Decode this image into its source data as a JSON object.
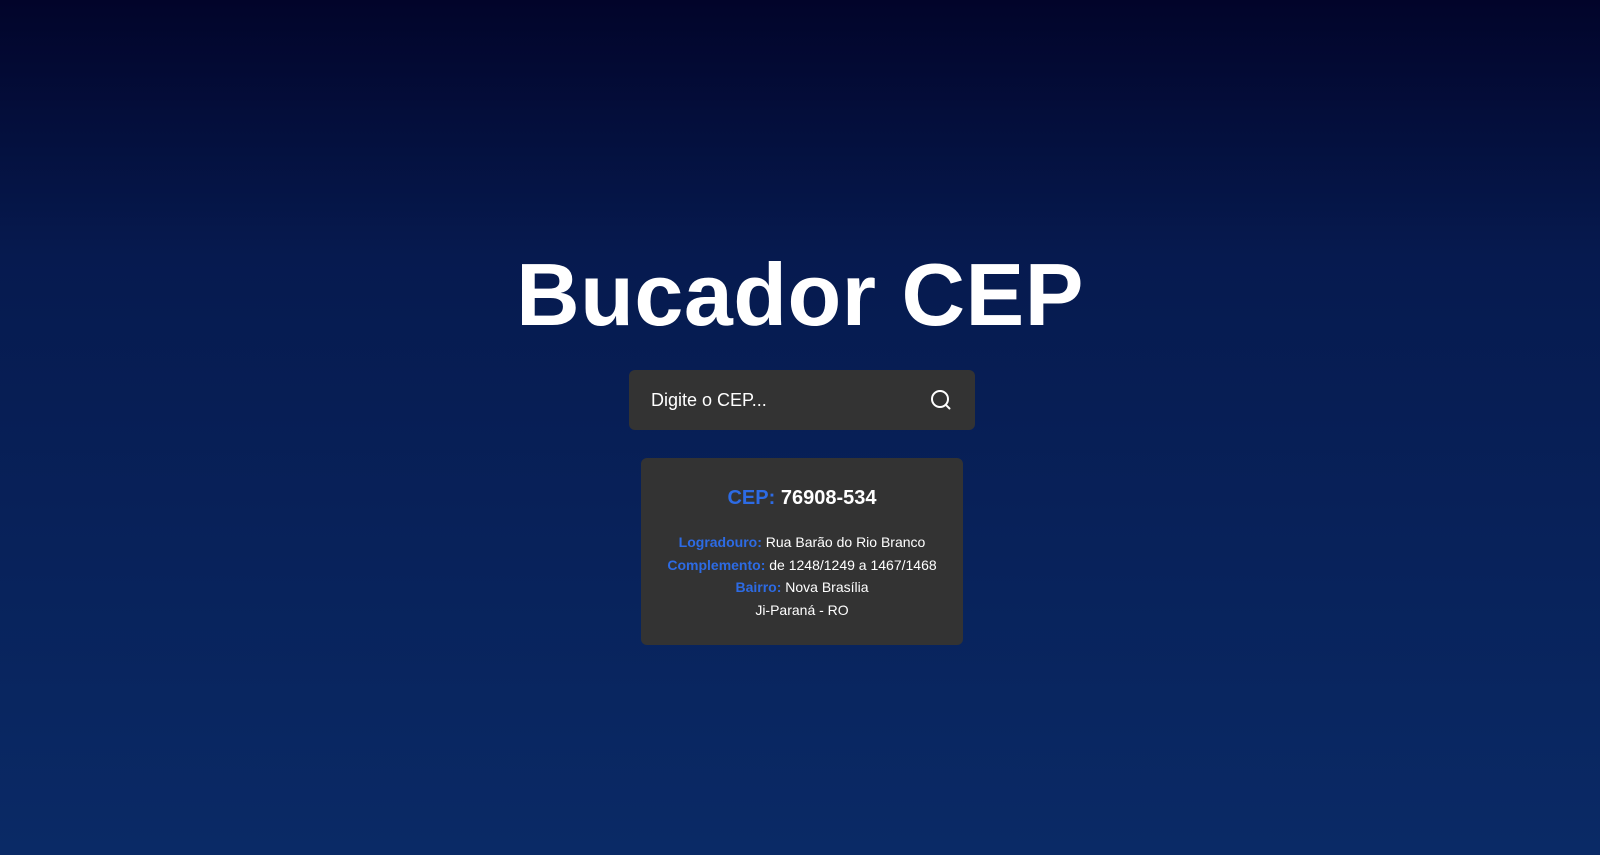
{
  "page": {
    "title": "Bucador CEP"
  },
  "search": {
    "placeholder": "Digite o CEP...",
    "value": "",
    "icon": "search-icon"
  },
  "result": {
    "cep_label": "CEP:",
    "cep_value": "76908-534",
    "logradouro_label": "Logradouro:",
    "logradouro_value": "Rua Barão do Rio Branco",
    "complemento_label": "Complemento:",
    "complemento_value": "de 1248/1249 a 1467/1468",
    "bairro_label": "Bairro:",
    "bairro_value": "Nova Brasília",
    "cidade_uf": "Ji-Paraná - RO"
  },
  "colors": {
    "background_top": "#02042a",
    "background_bottom": "#0a2a66",
    "panel": "#333333",
    "accent_blue": "#2d6be4",
    "text": "#ffffff"
  }
}
